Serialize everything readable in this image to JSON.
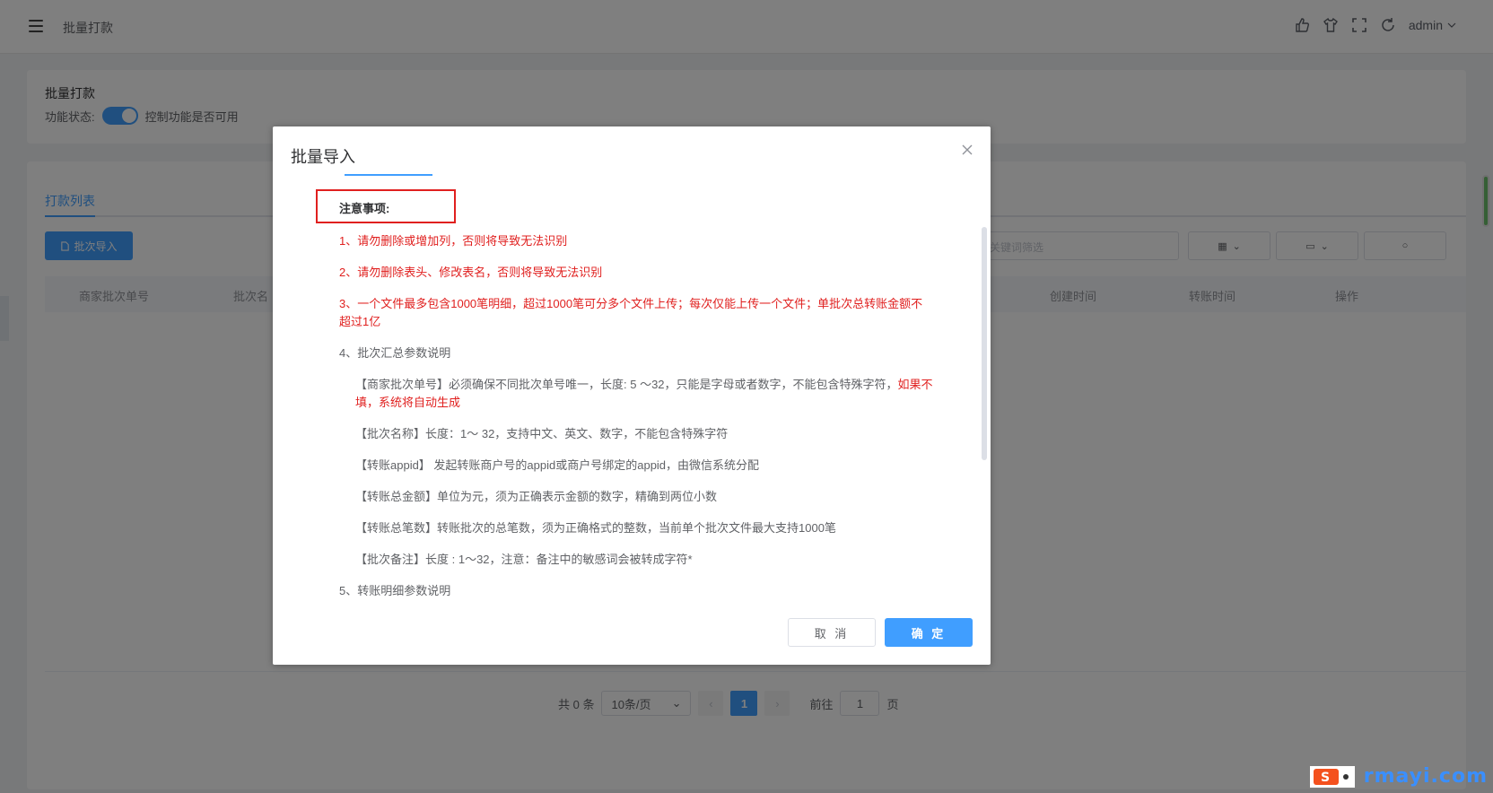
{
  "header": {
    "breadcrumb": "批量打款",
    "user": "admin",
    "icons": [
      "thumb-icon",
      "shirt-icon",
      "fullscreen-icon",
      "refresh-icon"
    ]
  },
  "status_card": {
    "title": "批量打款",
    "status_label": "功能状态:",
    "toggle_on": true,
    "hint": "控制功能是否可用"
  },
  "list": {
    "tab": "打款列表",
    "import_button": "批次导入",
    "search_placeholder": "关键词筛选",
    "columns": [
      "商家批次单号",
      "批次名",
      "创建时间",
      "转账时间",
      "操作"
    ],
    "pagination": {
      "total": "共 0 条",
      "page_size": "10条/页",
      "current_page": "1",
      "goto_label": "前往",
      "goto_value": "1",
      "page_suffix": "页"
    }
  },
  "dialog": {
    "title": "批量导入",
    "notice_label": "注意事项:",
    "items": [
      {
        "text": "1、请勿删除或增加列，否则将导致无法识别"
      },
      {
        "text": "2、请勿删除表头、修改表名，否则将导致无法识别"
      },
      {
        "text": "3、一个文件最多包含1000笔明细，超过1000笔可分多个文件上传；每次仅能上传一个文件；单批次总转账金额不超过1亿"
      },
      {
        "text": "4、批次汇总参数说明"
      },
      {
        "text_normal": "【商家批次单号】必须确保不同批次单号唯一，长度: 5 ～32，只能是字母或者数字，不能包含特殊字符，",
        "text_red": "如果不填，系统将自动生成"
      },
      {
        "text": "【批次名称】长度：1～ 32，支持中文、英文、数字，不能包含特殊字符"
      },
      {
        "text": "【转账appid】 发起转账商户号的appid或商户号绑定的appid，由微信系统分配"
      },
      {
        "text": "【转账总金额】单位为元，须为正确表示金额的数字，精确到两位小数"
      },
      {
        "text": "【转账总笔数】转账批次的总笔数，须为正确格式的整数，当前单个批次文件最大支持1000笔"
      },
      {
        "text": "【批次备注】长度 : 1～32，注意：备注中的敏感词会被转成字符*"
      },
      {
        "text": "5、转账明细参数说明"
      }
    ],
    "cancel": "取 消",
    "confirm": "确 定"
  },
  "watermark": "rmayi.com",
  "colors": {
    "primary": "#409eff",
    "danger": "#e0201f"
  }
}
